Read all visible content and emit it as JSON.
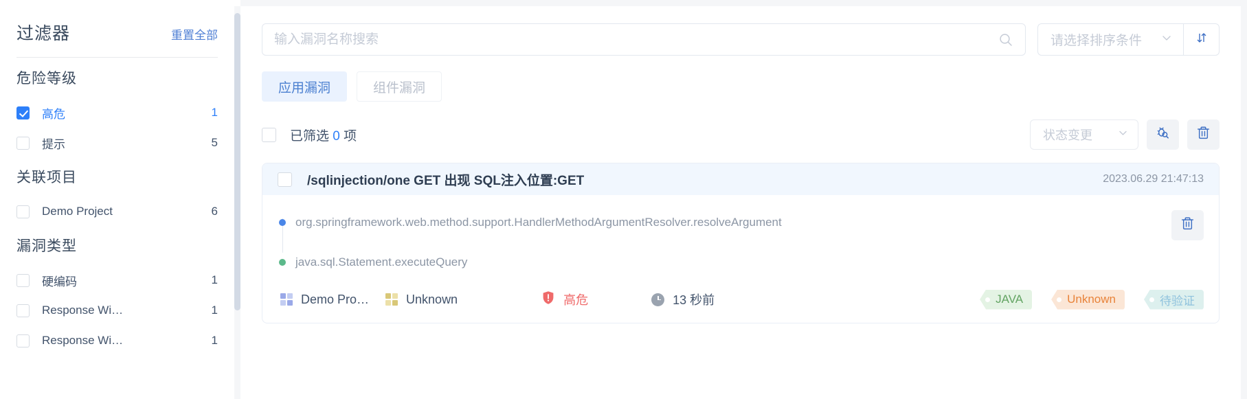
{
  "sidebar": {
    "header": {
      "title": "过滤器",
      "reset_label": "重置全部"
    },
    "groups": [
      {
        "title": "危险等级",
        "items": [
          {
            "label": "高危",
            "count": "1",
            "checked": true
          },
          {
            "label": "提示",
            "count": "5",
            "checked": false
          }
        ]
      },
      {
        "title": "关联项目",
        "items": [
          {
            "label": "Demo Project",
            "count": "6",
            "checked": false
          }
        ]
      },
      {
        "title": "漏洞类型",
        "items": [
          {
            "label": "硬编码",
            "count": "1",
            "checked": false
          },
          {
            "label": "Response Wi…",
            "count": "1",
            "checked": false
          },
          {
            "label": "Response Wi…",
            "count": "1",
            "checked": false
          }
        ]
      }
    ]
  },
  "toolbar": {
    "search_placeholder": "输入漏洞名称搜索",
    "search_value": "",
    "search_icon": "search-icon",
    "sort_select_placeholder": "请选择排序条件",
    "sort_chevron_icon": "chevron-down-icon",
    "sort_order_icon": "sort-updown-icon"
  },
  "tabs": [
    {
      "label": "应用漏洞",
      "active": true
    },
    {
      "label": "组件漏洞",
      "active": false
    }
  ],
  "select_row": {
    "checked": false,
    "filtered_prefix": "已筛选 ",
    "filtered_count": "0",
    "filtered_suffix": " 项",
    "status_select_label": "状态变更",
    "status_chevron_icon": "chevron-down-icon",
    "scan_icon": "bug-search-icon",
    "delete_icon": "trash-icon"
  },
  "vulnerability": {
    "checked": false,
    "title": "/sqlinjection/one GET 出现 SQL注入位置:GET",
    "timestamp": "2023.06.29 21:47:13",
    "delete_icon": "trash-icon",
    "trace": [
      {
        "text": "org.springframework.web.method.support.HandlerMethodArgumentResolver.resolveArgument",
        "dot_color": "#4a86e8"
      },
      {
        "text": "java.sql.Statement.executeQuery",
        "dot_color": "#5cb98b"
      }
    ],
    "meta": {
      "project": "Demo Pro…",
      "project_icon": "grid-icon",
      "project_icon_color": "#9aa9e8",
      "component": "Unknown",
      "component_icon": "grid-icon",
      "component_icon_color": "#d9c878",
      "severity": "高危",
      "severity_icon": "shield-alert-icon",
      "severity_color": "#ef6a6a",
      "time_ago": "13 秒前",
      "time_icon": "clock-icon"
    },
    "tags": [
      {
        "label": "JAVA",
        "bg": "#e4f3e4",
        "fg": "#63a463"
      },
      {
        "label": "Unknown",
        "bg": "#fbe6d6",
        "fg": "#e8833a"
      },
      {
        "label": "待验证",
        "bg": "#ddf0ee",
        "fg": "#8fc2dd"
      }
    ]
  },
  "colors": {
    "accent": "#2d7ff9",
    "card_header_bg": "#f1f7fe",
    "page_bg": "#f5f6f8"
  }
}
